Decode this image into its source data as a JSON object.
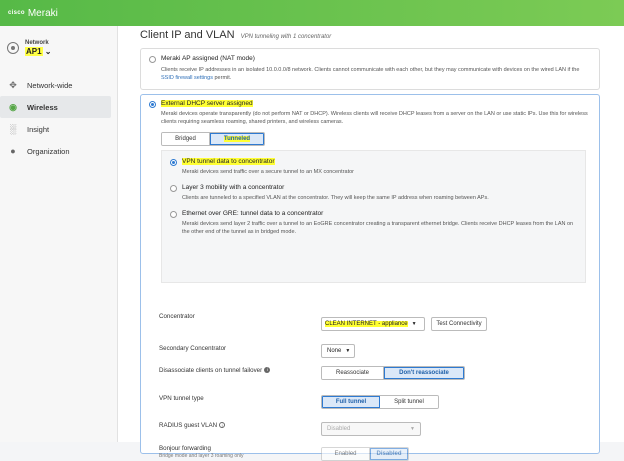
{
  "header": {
    "logo_text": "cisco",
    "brand": "Meraki",
    "colors": {
      "bar_start": "#56b947",
      "bar_end": "#7ccb55"
    }
  },
  "sidebar": {
    "network_label": "Network",
    "network_value": "AP1",
    "items": [
      {
        "label": "Network-wide",
        "icon": "network-wide-icon"
      },
      {
        "label": "Wireless",
        "icon": "wifi-icon"
      },
      {
        "label": "Insight",
        "icon": "bar-chart-icon"
      },
      {
        "label": "Organization",
        "icon": "building-icon"
      }
    ]
  },
  "page": {
    "title": "Client IP and VLAN",
    "subtitle": "VPN tunneling with 1 concentrator"
  },
  "nat_option": {
    "title": "Meraki AP assigned (NAT mode)",
    "desc": "Clients receive IP addresses in an isolated 10.0.0.0/8 network. Clients cannot communicate with each other, but they may communicate with devices on the wired LAN if the",
    "link": "SSID firewall settings",
    "desc_end": "permit."
  },
  "dhcp_option": {
    "title": "External DHCP server assigned",
    "desc": "Meraki devices operate transparently (do not perform NAT or DHCP). Wireless clients will receive DHCP leases from a server on the LAN or use static IPs. Use this for wireless clients requiring seamless roaming, shared printers, and wireless cameras."
  },
  "mode_segment": {
    "options": [
      "Bridged",
      "Tunneled"
    ],
    "selected": "Tunneled"
  },
  "tunnel_options": [
    {
      "title": "VPN tunnel data to concentrator",
      "desc": "Meraki devices send traffic over a secure tunnel to an MX concentrator"
    },
    {
      "title": "Layer 3 mobility with a concentrator",
      "desc": "Clients are tunneled to a specified VLAN at the concentrator. They will keep the same IP address when roaming between APs."
    },
    {
      "title": "Ethernet over GRE: tunnel data to a concentrator",
      "desc": "Meraki devices send layer 2 traffic over a tunnel to an EoGRE concentrator creating a transparent ethernet bridge. Clients receive DHCP leases from the LAN on the other end of the tunnel as in bridged mode."
    }
  ],
  "settings": {
    "concentrator_label": "Concentrator",
    "concentrator_value": "CLEAN INTERNET - appliance",
    "test_button": "Test Connectivity",
    "secondary_label": "Secondary Concentrator",
    "secondary_value": "None",
    "failover_label": "Disassociate clients on tunnel failover",
    "failover_options": [
      "Reassociate",
      "Don't reassociate"
    ],
    "failover_selected": "Don't reassociate",
    "tunnel_type_label": "VPN tunnel type",
    "tunnel_type_options": [
      "Full tunnel",
      "Split tunnel"
    ],
    "tunnel_type_selected": "Full tunnel",
    "radius_label": "RADIUS guest VLAN",
    "radius_value": "Disabled",
    "bonjour_label": "Bonjour forwarding",
    "bonjour_sub": "Bridge mode and layer 3 roaming only",
    "bonjour_options": [
      "Enabled",
      "Disabled"
    ],
    "bonjour_selected": "Disabled"
  }
}
